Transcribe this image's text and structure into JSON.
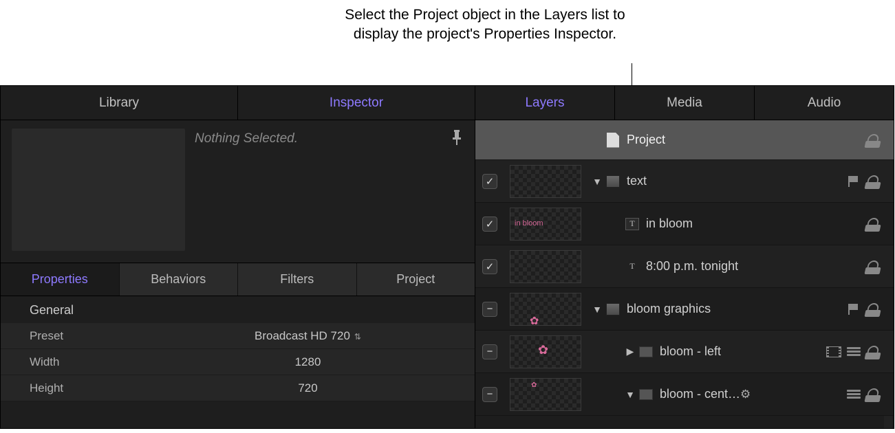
{
  "annotation": "Select the Project object in the Layers list to display the project's Properties Inspector.",
  "left_tabs": {
    "library": "Library",
    "inspector": "Inspector"
  },
  "preview": {
    "status": "Nothing Selected."
  },
  "sub_tabs": {
    "properties": "Properties",
    "behaviors": "Behaviors",
    "filters": "Filters",
    "project": "Project"
  },
  "properties": {
    "section": "General",
    "rows": [
      {
        "label": "Preset",
        "value": "Broadcast HD 720",
        "stepper": true
      },
      {
        "label": "Width",
        "value": "1280",
        "stepper": false
      },
      {
        "label": "Height",
        "value": "720",
        "stepper": false
      }
    ]
  },
  "right_tabs": {
    "layers": "Layers",
    "media": "Media",
    "audio": "Audio"
  },
  "layers": [
    {
      "kind": "project",
      "name": "Project"
    },
    {
      "kind": "group",
      "check": "check",
      "name": "text",
      "disclosure": "down",
      "flag": true
    },
    {
      "kind": "text",
      "check": "check",
      "name": "in bloom",
      "thumb_text": "in bloom"
    },
    {
      "kind": "text",
      "check": "check",
      "name": "8:00 p.m. tonight"
    },
    {
      "kind": "group",
      "check": "minus",
      "name": "bloom graphics",
      "disclosure": "down",
      "flag": true
    },
    {
      "kind": "clip",
      "check": "minus",
      "name": "bloom - left",
      "disclosure": "right",
      "film": true,
      "stack": true
    },
    {
      "kind": "clip",
      "check": "minus",
      "name": "bloom - cent…",
      "disclosure": "down",
      "gear": true,
      "stack": true
    }
  ]
}
